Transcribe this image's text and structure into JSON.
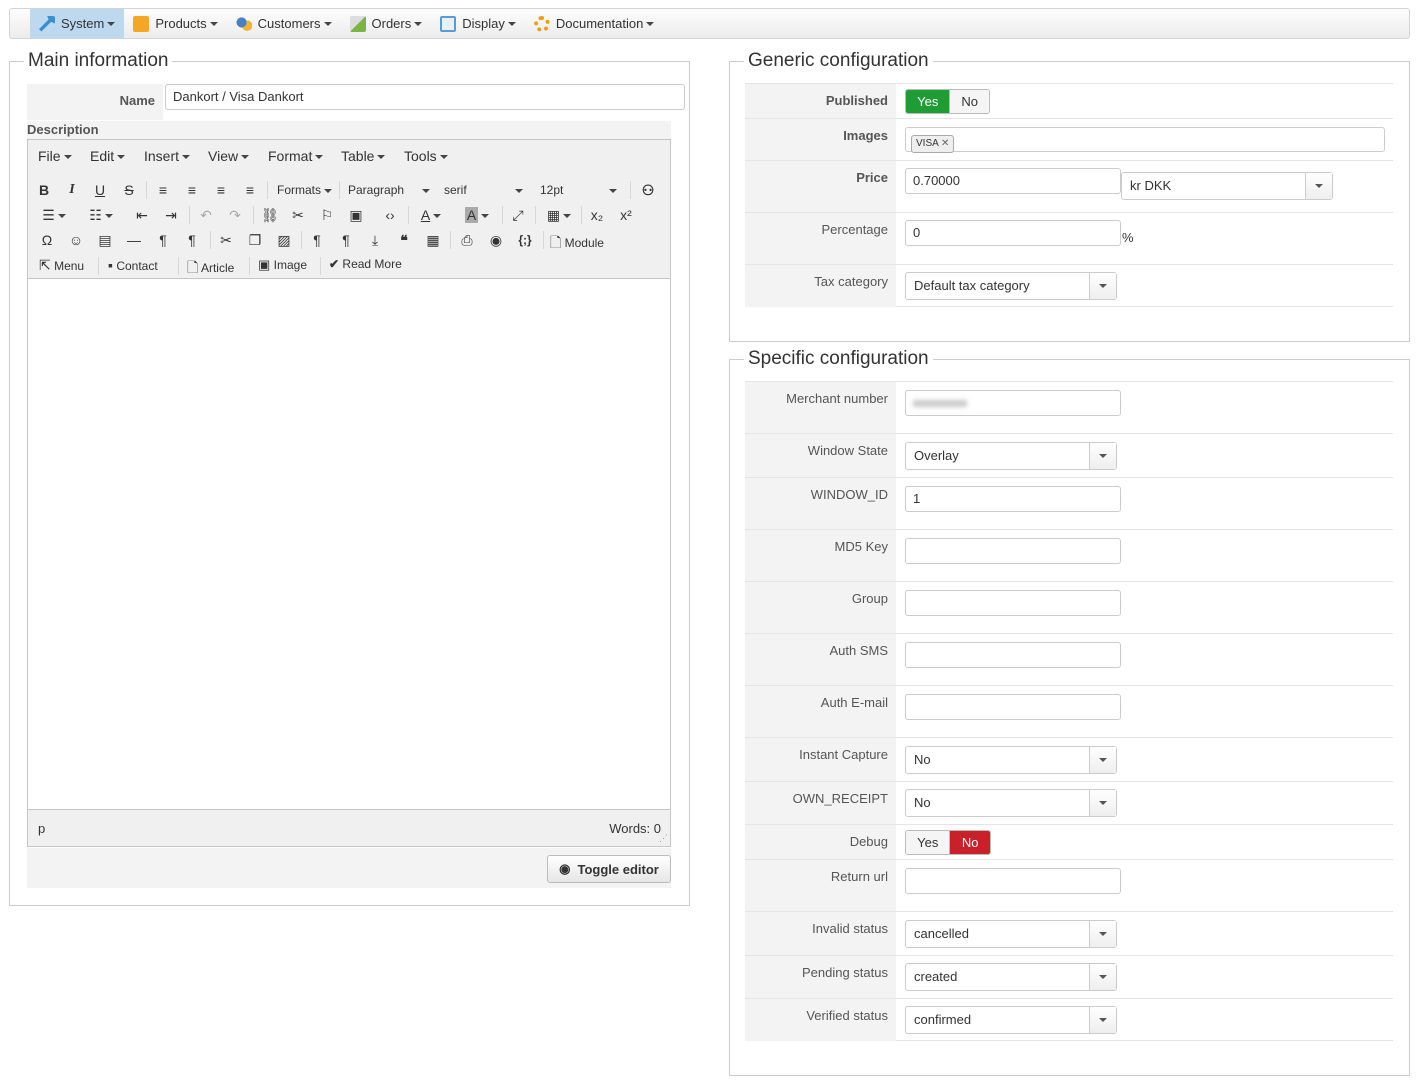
{
  "menu": {
    "items": [
      {
        "label": "System",
        "icon": "wrench-icon",
        "color": "#3a8fd0"
      },
      {
        "label": "Products",
        "icon": "box-icon",
        "color": "#f5a623"
      },
      {
        "label": "Customers",
        "icon": "users-icon",
        "color": "#4a7fc1"
      },
      {
        "label": "Orders",
        "icon": "orders-icon",
        "color": "#7cb342"
      },
      {
        "label": "Display",
        "icon": "display-icon",
        "color": "#5a9bd5"
      },
      {
        "label": "Documentation",
        "icon": "lifebuoy-icon",
        "color": "#f39c12"
      }
    ]
  },
  "main": {
    "legend": "Main information",
    "name_label": "Name",
    "name_value": "Dankort / Visa Dankort",
    "description_label": "Description",
    "editor": {
      "menus": [
        "File",
        "Edit",
        "Insert",
        "View",
        "Format",
        "Table",
        "Tools"
      ],
      "formats": "Formats",
      "paragraph": "Paragraph",
      "font": "serif",
      "size": "12pt",
      "module": "Module",
      "menu_btn": "Menu",
      "contact": "Contact",
      "article": "Article",
      "image": "Image",
      "readmore": "Read More",
      "path": "p",
      "words": "Words: 0"
    },
    "toggle_editor": "Toggle editor"
  },
  "generic": {
    "legend": "Generic configuration",
    "published_label": "Published",
    "yes": "Yes",
    "no": "No",
    "images_label": "Images",
    "image_tag": "VISA",
    "price_label": "Price",
    "price_value": "0.70000",
    "currency": "kr DKK",
    "percentage_label": "Percentage",
    "percentage_value": "0",
    "percent_sign": "%",
    "tax_label": "Tax category",
    "tax_value": "Default tax category"
  },
  "specific": {
    "legend": "Specific configuration",
    "merchant_label": "Merchant number",
    "window_state_label": "Window State",
    "window_state_value": "Overlay",
    "window_id_label": "WINDOW_ID",
    "window_id_value": "1",
    "md5_label": "MD5 Key",
    "group_label": "Group",
    "authsms_label": "Auth SMS",
    "authemail_label": "Auth E-mail",
    "instant_label": "Instant Capture",
    "instant_value": "No",
    "own_label": "OWN_RECEIPT",
    "own_value": "No",
    "debug_label": "Debug",
    "yes": "Yes",
    "no": "No",
    "return_label": "Return url",
    "invalid_label": "Invalid status",
    "invalid_value": "cancelled",
    "pending_label": "Pending status",
    "pending_value": "created",
    "verified_label": "Verified status",
    "verified_value": "confirmed"
  },
  "colors": {
    "green": "#1f9d35",
    "red": "#c9202a",
    "accent": "#bcd9f0"
  }
}
